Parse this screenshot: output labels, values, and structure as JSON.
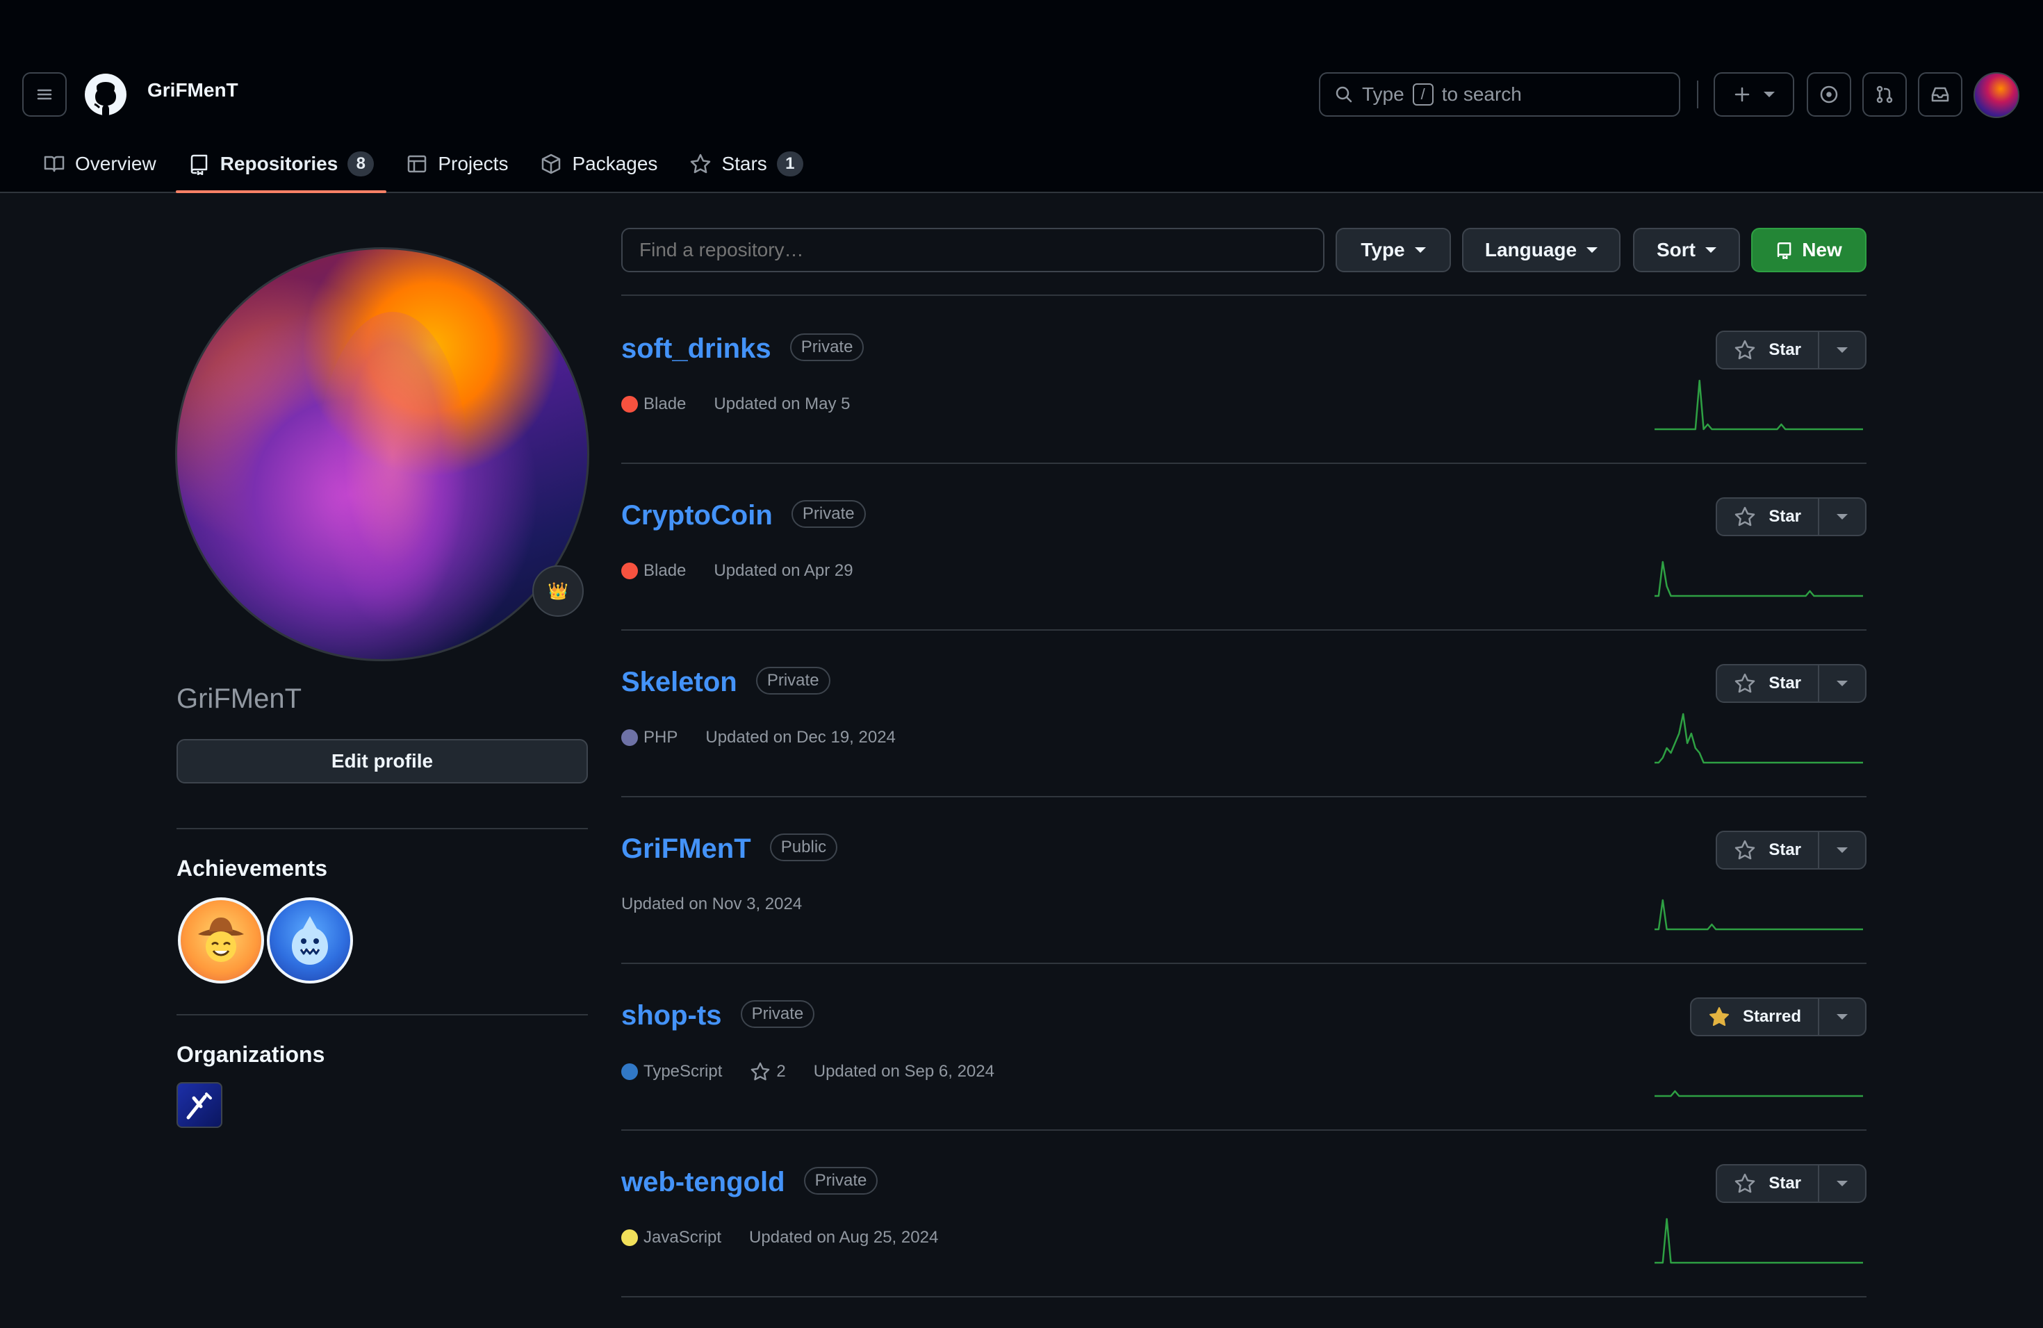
{
  "header": {
    "username": "GriFMenT",
    "search": {
      "prefix": "Type",
      "key": "/",
      "suffix": "to search"
    }
  },
  "tabs": [
    {
      "label": "Overview",
      "icon": "book-icon"
    },
    {
      "label": "Repositories",
      "icon": "repo-icon",
      "count": "8",
      "active": true
    },
    {
      "label": "Projects",
      "icon": "table-icon"
    },
    {
      "label": "Packages",
      "icon": "package-icon"
    },
    {
      "label": "Stars",
      "icon": "star-icon",
      "count": "1"
    }
  ],
  "profile": {
    "name": "GriFMenT",
    "edit_label": "Edit profile",
    "status_emoji": "👑",
    "achievements_title": "Achievements",
    "organizations_title": "Organizations"
  },
  "toolbar": {
    "find_placeholder": "Find a repository…",
    "type_label": "Type",
    "language_label": "Language",
    "sort_label": "Sort",
    "new_label": "New"
  },
  "colors": {
    "accent_link": "#4493f8",
    "new_button": "#238636",
    "spark": "#2ea043",
    "tab_underline": "#f78166"
  },
  "repos": [
    {
      "name": "soft_drinks",
      "visibility": "Private",
      "language": "Blade",
      "lang_color": "#f7523f",
      "stars": "",
      "updated": "Updated on May 5",
      "star_label": "Star",
      "starred": false,
      "activity": [
        0,
        0,
        0,
        0,
        0,
        0,
        0,
        0,
        0,
        0,
        0,
        10,
        0,
        1,
        0,
        0,
        0,
        0,
        0,
        0,
        0,
        0,
        0,
        0,
        0,
        0,
        0,
        0,
        0,
        0,
        0,
        1,
        0,
        0,
        0,
        0,
        0,
        0,
        0,
        0,
        0,
        0,
        0,
        0,
        0,
        0,
        0,
        0,
        0,
        0,
        0,
        0
      ]
    },
    {
      "name": "CryptoCoin",
      "visibility": "Private",
      "language": "Blade",
      "lang_color": "#f7523f",
      "stars": "",
      "updated": "Updated on Apr 29",
      "star_label": "Star",
      "starred": false,
      "activity": [
        0,
        0,
        7,
        2,
        0,
        0,
        0,
        0,
        0,
        0,
        0,
        0,
        0,
        0,
        0,
        0,
        0,
        0,
        0,
        0,
        0,
        0,
        0,
        0,
        0,
        0,
        0,
        0,
        0,
        0,
        0,
        0,
        0,
        0,
        0,
        0,
        0,
        0,
        1,
        0,
        0,
        0,
        0,
        0,
        0,
        0,
        0,
        0,
        0,
        0,
        0,
        0
      ]
    },
    {
      "name": "Skeleton",
      "visibility": "Private",
      "language": "PHP",
      "lang_color": "#6e72a6",
      "stars": "",
      "updated": "Updated on Dec 19, 2024",
      "star_label": "Star",
      "starred": false,
      "activity": [
        0,
        0,
        1,
        3,
        2,
        4,
        6,
        10,
        4,
        6,
        3,
        2,
        0,
        0,
        0,
        0,
        0,
        0,
        0,
        0,
        0,
        0,
        0,
        0,
        0,
        0,
        0,
        0,
        0,
        0,
        0,
        0,
        0,
        0,
        0,
        0,
        0,
        0,
        0,
        0,
        0,
        0,
        0,
        0,
        0,
        0,
        0,
        0,
        0,
        0,
        0,
        0
      ]
    },
    {
      "name": "GriFMenT",
      "visibility": "Public",
      "language": "",
      "lang_color": "",
      "stars": "",
      "updated": "Updated on Nov 3, 2024",
      "star_label": "Star",
      "starred": false,
      "activity": [
        0,
        0,
        6,
        0,
        0,
        0,
        0,
        0,
        0,
        0,
        0,
        0,
        0,
        0,
        1,
        0,
        0,
        0,
        0,
        0,
        0,
        0,
        0,
        0,
        0,
        0,
        0,
        0,
        0,
        0,
        0,
        0,
        0,
        0,
        0,
        0,
        0,
        0,
        0,
        0,
        0,
        0,
        0,
        0,
        0,
        0,
        0,
        0,
        0,
        0,
        0,
        0
      ]
    },
    {
      "name": "shop-ts",
      "visibility": "Private",
      "language": "TypeScript",
      "lang_color": "#3178c6",
      "stars": "2",
      "updated": "Updated on Sep 6, 2024",
      "star_label": "Starred",
      "starred": true,
      "activity": [
        0,
        0,
        0,
        0,
        0,
        1,
        0,
        0,
        0,
        0,
        0,
        0,
        0,
        0,
        0,
        0,
        0,
        0,
        0,
        0,
        0,
        0,
        0,
        0,
        0,
        0,
        0,
        0,
        0,
        0,
        0,
        0,
        0,
        0,
        0,
        0,
        0,
        0,
        0,
        0,
        0,
        0,
        0,
        0,
        0,
        0,
        0,
        0,
        0,
        0,
        0,
        0
      ]
    },
    {
      "name": "web-tengold",
      "visibility": "Private",
      "language": "JavaScript",
      "lang_color": "#f1e05a",
      "stars": "",
      "updated": "Updated on Aug 25, 2024",
      "star_label": "Star",
      "starred": false,
      "activity": [
        0,
        0,
        0,
        9,
        0,
        0,
        0,
        0,
        0,
        0,
        0,
        0,
        0,
        0,
        0,
        0,
        0,
        0,
        0,
        0,
        0,
        0,
        0,
        0,
        0,
        0,
        0,
        0,
        0,
        0,
        0,
        0,
        0,
        0,
        0,
        0,
        0,
        0,
        0,
        0,
        0,
        0,
        0,
        0,
        0,
        0,
        0,
        0,
        0,
        0,
        0,
        0
      ]
    }
  ]
}
